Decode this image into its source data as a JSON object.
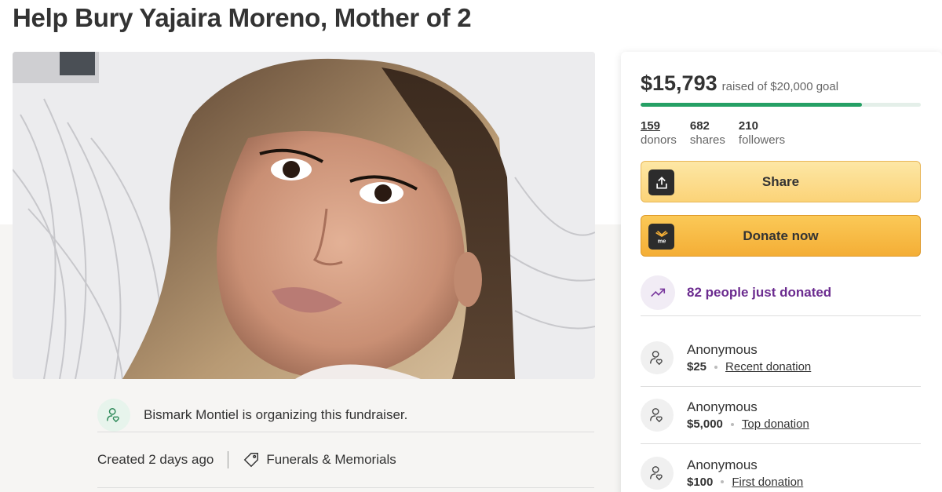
{
  "campaign": {
    "title": "Help Bury Yajaira Moreno, Mother of 2",
    "organizer_text": "Bismark Montiel is organizing this fundraiser.",
    "created": "Created 2 days ago",
    "category": "Funerals & Memorials"
  },
  "progress": {
    "raised": "$15,793",
    "goal_text": "raised of $20,000 goal",
    "fraction": 0.79
  },
  "stats": [
    {
      "value": "159",
      "label": "donors"
    },
    {
      "value": "682",
      "label": "shares"
    },
    {
      "value": "210",
      "label": "followers"
    }
  ],
  "buttons": {
    "share_label": "Share",
    "donate_label": "Donate now"
  },
  "momentum": {
    "text": "82 people just donated"
  },
  "donations": [
    {
      "name": "Anonymous",
      "amount": "$25",
      "tag": "Recent donation"
    },
    {
      "name": "Anonymous",
      "amount": "$5,000",
      "tag": "Top donation"
    },
    {
      "name": "Anonymous",
      "amount": "$100",
      "tag": "First donation"
    }
  ],
  "colors": {
    "progress_fill": "#25a065",
    "donate_button": "#f4ae36",
    "share_button": "#fbd378",
    "momentum_text": "#6b2b8f"
  },
  "icons": {
    "share": "share-upload-icon",
    "donate": "gofundme-icon",
    "momentum": "trending-up-icon",
    "donor": "donor-heart-icon",
    "organizer": "organizer-heart-icon",
    "category": "tag-icon"
  }
}
